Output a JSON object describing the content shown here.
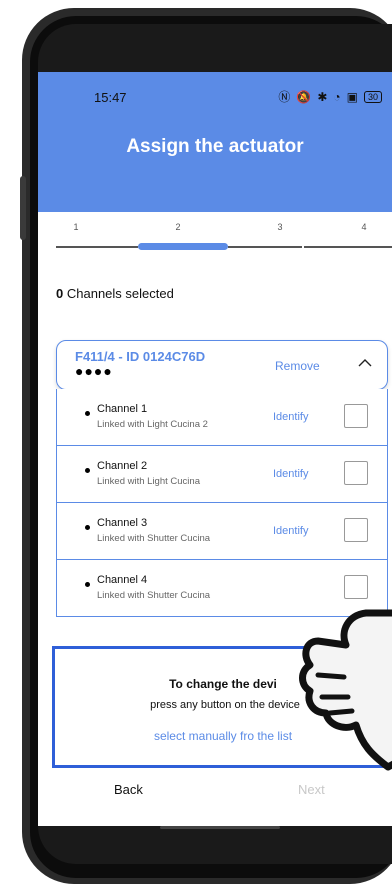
{
  "status_bar": {
    "time": "15:47",
    "battery": "30"
  },
  "header": {
    "title": "Assign the actuator"
  },
  "stepper": {
    "steps": [
      "1",
      "2",
      "3",
      "4"
    ],
    "active_step": 2
  },
  "selection": {
    "count": "0",
    "label": "Channels selected"
  },
  "device": {
    "name": "F411/4 - ID 0124C76D",
    "dots": "●●●●",
    "remove_label": "Remove"
  },
  "channels": [
    {
      "name": "Channel 1",
      "link": "Linked with Light Cucina 2",
      "identify": "Identify"
    },
    {
      "name": "Channel 2",
      "link": "Linked with Light Cucina",
      "identify": "Identify"
    },
    {
      "name": "Channel 3",
      "link": "Linked with Shutter Cucina",
      "identify": "Identify"
    },
    {
      "name": "Channel 4",
      "link": "Linked with Shutter Cucina",
      "identify": ""
    }
  ],
  "info": {
    "title": "To change the devi",
    "text": "press any button on the device",
    "link": "select manually fro   the list"
  },
  "nav": {
    "back": "Back",
    "next": "Next"
  },
  "colors": {
    "accent": "#5b8be6",
    "info_border": "#2f5fd8",
    "next_disabled": "#c8c8c8"
  }
}
